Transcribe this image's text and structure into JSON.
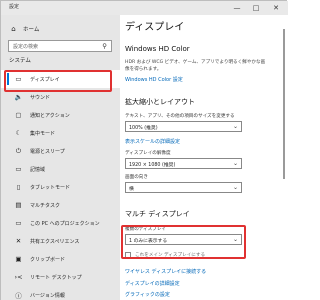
{
  "window": {
    "title": "設定",
    "minimize": "—",
    "maximize": "□",
    "close": "✕"
  },
  "sidebar": {
    "home": {
      "icon": "⌂",
      "label": "ホーム"
    },
    "search_placeholder": "設定の検索",
    "search_icon": "⚲",
    "section": "システム",
    "items": [
      {
        "icon": "▭",
        "label": "ディスプレイ"
      },
      {
        "icon": "🔈",
        "label": "サウンド"
      },
      {
        "icon": "▢",
        "label": "通知とアクション"
      },
      {
        "icon": "☾",
        "label": "集中モード"
      },
      {
        "icon": "⏻",
        "label": "電源とスリープ"
      },
      {
        "icon": "▭",
        "label": "記憶域"
      },
      {
        "icon": "▯",
        "label": "タブレットモード"
      },
      {
        "icon": "▤",
        "label": "マルチタスク"
      },
      {
        "icon": "▭",
        "label": "この PC へのプロジェクション"
      },
      {
        "icon": "✕",
        "label": "共有エクスペリエンス"
      },
      {
        "icon": "▣",
        "label": "クリップボード"
      },
      {
        "icon": "›<",
        "label": "リモート デスクトップ"
      },
      {
        "icon": "ⓘ",
        "label": "バージョン情報"
      }
    ]
  },
  "main": {
    "title": "ディスプレイ",
    "hd_color": {
      "heading": "Windows HD Color",
      "text1": "HDR および WCG ビデオ、ゲーム、アプリでより明るく鮮やかな画",
      "text2": "像を得られます。",
      "link": "Windows HD Color 設定"
    },
    "scale": {
      "heading": "拡大縮小とレイアウト",
      "text_label": "テキスト、アプリ、その他の項目のサイズを変更する",
      "text_value": "100% (推奨)",
      "advanced_link": "表示スケールの詳細設定",
      "resolution_label": "ディスプレイの解像度",
      "resolution_value": "1920 × 1080 (推奨)",
      "orientation_label": "画面の向き",
      "orientation_value": "横"
    },
    "multi": {
      "heading": "マルチ ディスプレイ",
      "label": "複数のディスプレイ",
      "value": "1 のみに表示する",
      "checkbox": "これをメイン ディスプレイにする",
      "wireless_link": "ワイヤレス ディスプレイに接続する",
      "link_detail": "ディスプレイの詳細設定",
      "link_graphics": "グラフィックの設定"
    }
  }
}
